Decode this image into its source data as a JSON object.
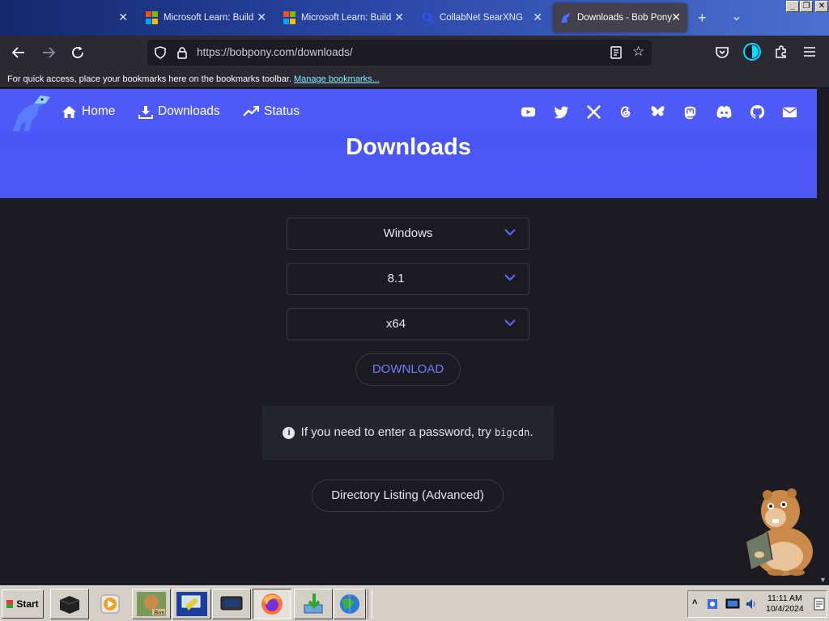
{
  "browser": {
    "tabs": [
      {
        "title": "",
        "active": false
      },
      {
        "title": "Microsoft Learn: Build s",
        "active": false
      },
      {
        "title": "Microsoft Learn: Build s",
        "active": false
      },
      {
        "title": "CollabNet SearXNG",
        "active": false
      },
      {
        "title": "Downloads - Bob Pony",
        "active": true
      }
    ],
    "url_host": "https://bobpony.com",
    "url_path": "/downloads/",
    "bookmarks_hint": "For quick access, place your bookmarks here on the bookmarks toolbar.",
    "bookmarks_link": "Manage bookmarks..."
  },
  "site": {
    "nav": [
      {
        "label": "Home",
        "icon": "home-icon"
      },
      {
        "label": "Downloads",
        "icon": "download-icon"
      },
      {
        "label": "Status",
        "icon": "trending-up-icon"
      }
    ],
    "social_icons": [
      "youtube-icon",
      "twitter-icon",
      "x-icon",
      "threads-icon",
      "bluesky-icon",
      "mastodon-icon",
      "discord-icon",
      "github-icon",
      "email-icon"
    ],
    "page_title": "Downloads",
    "selects": {
      "os": "Windows",
      "version": "8.1",
      "arch": "x64"
    },
    "download_label": "DOWNLOAD",
    "notice_text": "If you need to enter a password, try",
    "notice_code": "bigcdn",
    "notice_end": ".",
    "directory_label": "Directory Listing (Advanced)",
    "colors": {
      "hero": "#4e5af7",
      "accent": "#6f7dff",
      "background": "#1c1b22"
    }
  },
  "taskbar": {
    "start_label": "Start",
    "time": "11:11 AM",
    "date": "10/4/2024"
  }
}
